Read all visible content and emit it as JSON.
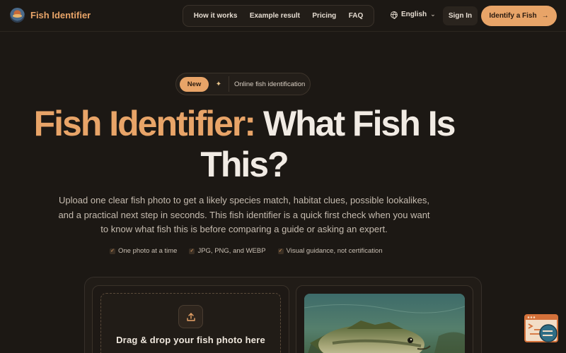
{
  "brand": {
    "name": "Fish Identifier"
  },
  "nav": {
    "links": [
      "How it works",
      "Example result",
      "Pricing",
      "FAQ"
    ],
    "language": "English",
    "sign_in": "Sign In",
    "cta": "Identify a Fish",
    "cta_arrow": "→"
  },
  "badge": {
    "tag": "New",
    "sparkle": "✦",
    "text": "Online fish identification"
  },
  "hero": {
    "title_accent": "Fish Identifier:",
    "title_rest": " What Fish Is This?",
    "subtitle": "Upload one clear fish photo to get a likely species match, habitat clues, possible lookalikes, and a practical next step in seconds. This fish identifier is a quick first check when you want to know what fish this is before comparing a guide or asking an expert."
  },
  "checks": [
    "One photo at a time",
    "JPG, PNG, and WEBP",
    "Visual guidance, not certification"
  ],
  "upload": {
    "title": "Drag & drop your fish photo here"
  },
  "colors": {
    "accent": "#e8a468",
    "background": "#1c1814"
  }
}
